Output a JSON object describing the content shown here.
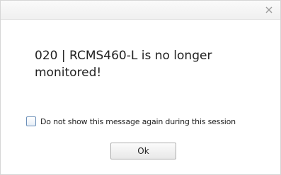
{
  "dialog": {
    "close_icon": "close-x-icon",
    "message": "020 | RCMS460-L is no longer monitored!",
    "checkbox_label": "Do not show this message again during this session",
    "checkbox_checked": false,
    "ok_label": "Ok"
  },
  "colors": {
    "checkbox_border": "#6b8fb8",
    "text": "#222222"
  }
}
